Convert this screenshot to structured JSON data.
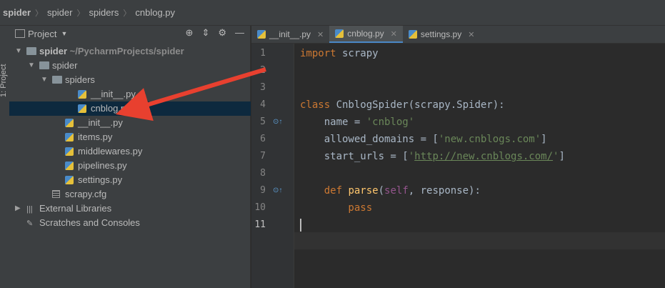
{
  "breadcrumb": [
    "spider",
    "spider",
    "spiders",
    "cnblog.py"
  ],
  "toolstrip_label": "1: Project",
  "panel": {
    "title": "Project"
  },
  "tree": [
    {
      "name": "spider",
      "sub": "~/PycharmProjects/spider",
      "type": "folder",
      "level": 0,
      "arrow": "▼"
    },
    {
      "name": "spider",
      "sub": "",
      "type": "folder",
      "level": 1,
      "arrow": "▼"
    },
    {
      "name": "spiders",
      "sub": "",
      "type": "folder",
      "level": 2,
      "arrow": "▼"
    },
    {
      "name": "__init__.py",
      "sub": "",
      "type": "py",
      "level": 4,
      "arrow": ""
    },
    {
      "name": "cnblog.py",
      "sub": "",
      "type": "py",
      "level": 4,
      "arrow": "",
      "selected": true
    },
    {
      "name": "__init__.py",
      "sub": "",
      "type": "py",
      "level": 3,
      "arrow": ""
    },
    {
      "name": "items.py",
      "sub": "",
      "type": "py",
      "level": 3,
      "arrow": ""
    },
    {
      "name": "middlewares.py",
      "sub": "",
      "type": "py",
      "level": 3,
      "arrow": ""
    },
    {
      "name": "pipelines.py",
      "sub": "",
      "type": "py",
      "level": 3,
      "arrow": ""
    },
    {
      "name": "settings.py",
      "sub": "",
      "type": "py",
      "level": 3,
      "arrow": ""
    },
    {
      "name": "scrapy.cfg",
      "sub": "",
      "type": "cfg",
      "level": 2,
      "arrow": ""
    },
    {
      "name": "External Libraries",
      "sub": "",
      "type": "lib",
      "level": 0,
      "arrow": "▶"
    },
    {
      "name": "Scratches and Consoles",
      "sub": "",
      "type": "scratch",
      "level": 0,
      "arrow": ""
    }
  ],
  "tabs": [
    {
      "label": "__init__.py",
      "active": false
    },
    {
      "label": "cnblog.py",
      "active": true
    },
    {
      "label": "settings.py",
      "active": false
    }
  ],
  "code": {
    "line_numbers": [
      "1",
      "2",
      "3",
      "4",
      "5",
      "6",
      "7",
      "8",
      "9",
      "10",
      "11"
    ],
    "lines": [
      [
        [
          "kw",
          "import"
        ],
        [
          "id",
          " scrapy"
        ]
      ],
      [],
      [],
      [
        [
          "kw",
          "class "
        ],
        [
          "id",
          "CnblogSpider(scrapy.Spider):"
        ]
      ],
      [
        [
          "id",
          "    name = "
        ],
        [
          "str",
          "'cnblog'"
        ]
      ],
      [
        [
          "id",
          "    allowed_domains = ["
        ],
        [
          "str",
          "'new.cnblogs.com'"
        ],
        [
          "id",
          "]"
        ]
      ],
      [
        [
          "id",
          "    start_urls = ["
        ],
        [
          "str",
          "'"
        ],
        [
          "strlink",
          "http://new.cnblogs.com/"
        ],
        [
          "str",
          "'"
        ],
        [
          "id",
          "]"
        ]
      ],
      [],
      [
        [
          "kw",
          "    def "
        ],
        [
          "fn",
          "parse"
        ],
        [
          "id",
          "("
        ],
        [
          "slf",
          "self"
        ],
        [
          "id",
          ", response):"
        ]
      ],
      [
        [
          "kw",
          "        pass"
        ]
      ],
      []
    ]
  },
  "colors": {
    "accent": "#4a88c7",
    "annotation_arrow": "#e8402f"
  }
}
